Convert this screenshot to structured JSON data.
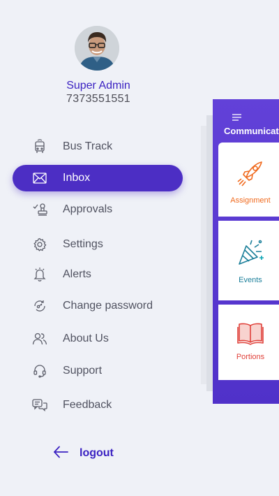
{
  "profile": {
    "name": "Super Admin",
    "phone": "7373551551"
  },
  "menu": [
    {
      "label": "Bus Track",
      "icon": "bus-icon",
      "active": false
    },
    {
      "label": "Inbox",
      "icon": "mail-icon",
      "active": true
    },
    {
      "label": "Approvals",
      "icon": "approval-stamp-icon",
      "active": false
    },
    {
      "label": "Settings",
      "icon": "gear-icon",
      "active": false
    },
    {
      "label": "Alerts",
      "icon": "bell-icon",
      "active": false
    },
    {
      "label": "Change password",
      "icon": "key-refresh-icon",
      "active": false
    },
    {
      "label": "About Us",
      "icon": "users-icon",
      "active": false
    },
    {
      "label": "Support",
      "icon": "headset-icon",
      "active": false
    },
    {
      "label": "Feedback",
      "icon": "feedback-chat-icon",
      "active": false
    }
  ],
  "logout": {
    "label": "logout",
    "icon": "arrow-left-icon"
  },
  "preview": {
    "title": "Communicat",
    "cards": [
      {
        "label": "Assignment",
        "icon": "rocket-icon",
        "color": "#f06a1e"
      },
      {
        "label": "Events",
        "icon": "party-popper-icon",
        "color": "#1b7f9a"
      },
      {
        "label": "Portions",
        "icon": "book-icon",
        "color": "#e0413a"
      }
    ]
  },
  "colors": {
    "accent": "#4c2ec4",
    "background": "#eff1f7",
    "name_text": "#3b22c2"
  }
}
